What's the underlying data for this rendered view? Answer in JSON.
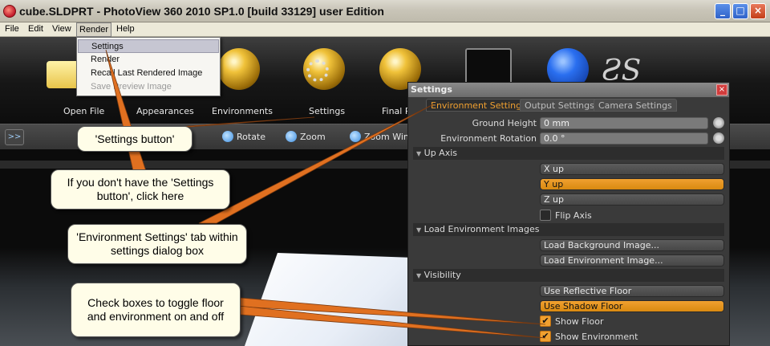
{
  "window": {
    "title": "cube.SLDPRT - PhotoView 360 2010 SP1.0 [build 33129] user Edition",
    "min_glyph": "_",
    "max_glyph": "□",
    "close_glyph": "×"
  },
  "menubar": {
    "items": [
      "File",
      "Edit",
      "View",
      "Render",
      "Help"
    ],
    "active": "Render"
  },
  "render_menu": {
    "items": [
      "Settings",
      "Render",
      "Recall Last Rendered Image",
      "Save Preview Image"
    ],
    "highlighted": "Settings",
    "disabled": [
      "Save Preview Image"
    ]
  },
  "ribbon": {
    "labels": [
      "Open File",
      "Appearances",
      "Environments",
      "Settings",
      "Final Render"
    ]
  },
  "toolbar2": {
    "expand_label": ">>",
    "tools": [
      "Rotate",
      "Zoom",
      "Zoom Window"
    ]
  },
  "dialog": {
    "title": "Settings",
    "close_glyph": "×",
    "tabs": [
      "Environment Settings",
      "Output Settings",
      "Camera Settings"
    ],
    "active_tab": "Environment Settings",
    "ground_height": {
      "label": "Ground Height",
      "value": "0 mm"
    },
    "env_rotation": {
      "label": "Environment Rotation",
      "value": "0.0 °"
    },
    "sections": {
      "up_axis": "Up Axis",
      "load_env_images": "Load Environment Images",
      "visibility": "Visibility"
    },
    "section_arrow": "▼",
    "up_axis_options": [
      "X up",
      "Y up",
      "Z up"
    ],
    "up_axis_selected": "Y up",
    "flip_axis": {
      "label": "Flip Axis",
      "checked": false
    },
    "load_buttons": [
      "Load Background Image...",
      "Load Environment Image..."
    ],
    "floor_options": [
      "Use Reflective Floor",
      "Use Shadow Floor"
    ],
    "floor_selected": "Use Shadow Floor",
    "show_floor": {
      "label": "Show Floor",
      "checked": true
    },
    "show_environment": {
      "label": "Show Environment",
      "checked": true
    },
    "check_glyph": "✔"
  },
  "callouts": {
    "settings_button": "'Settings button'",
    "no_settings_button": "If you don't have the 'Settings button', click here",
    "env_tab": "'Environment Settings' tab within settings dialog box",
    "check_boxes": "Check boxes to toggle floor and environment on and off"
  },
  "colors": {
    "accent": "#f0a030",
    "callout_bg": "#fffde8",
    "arrow": "#e07020"
  }
}
